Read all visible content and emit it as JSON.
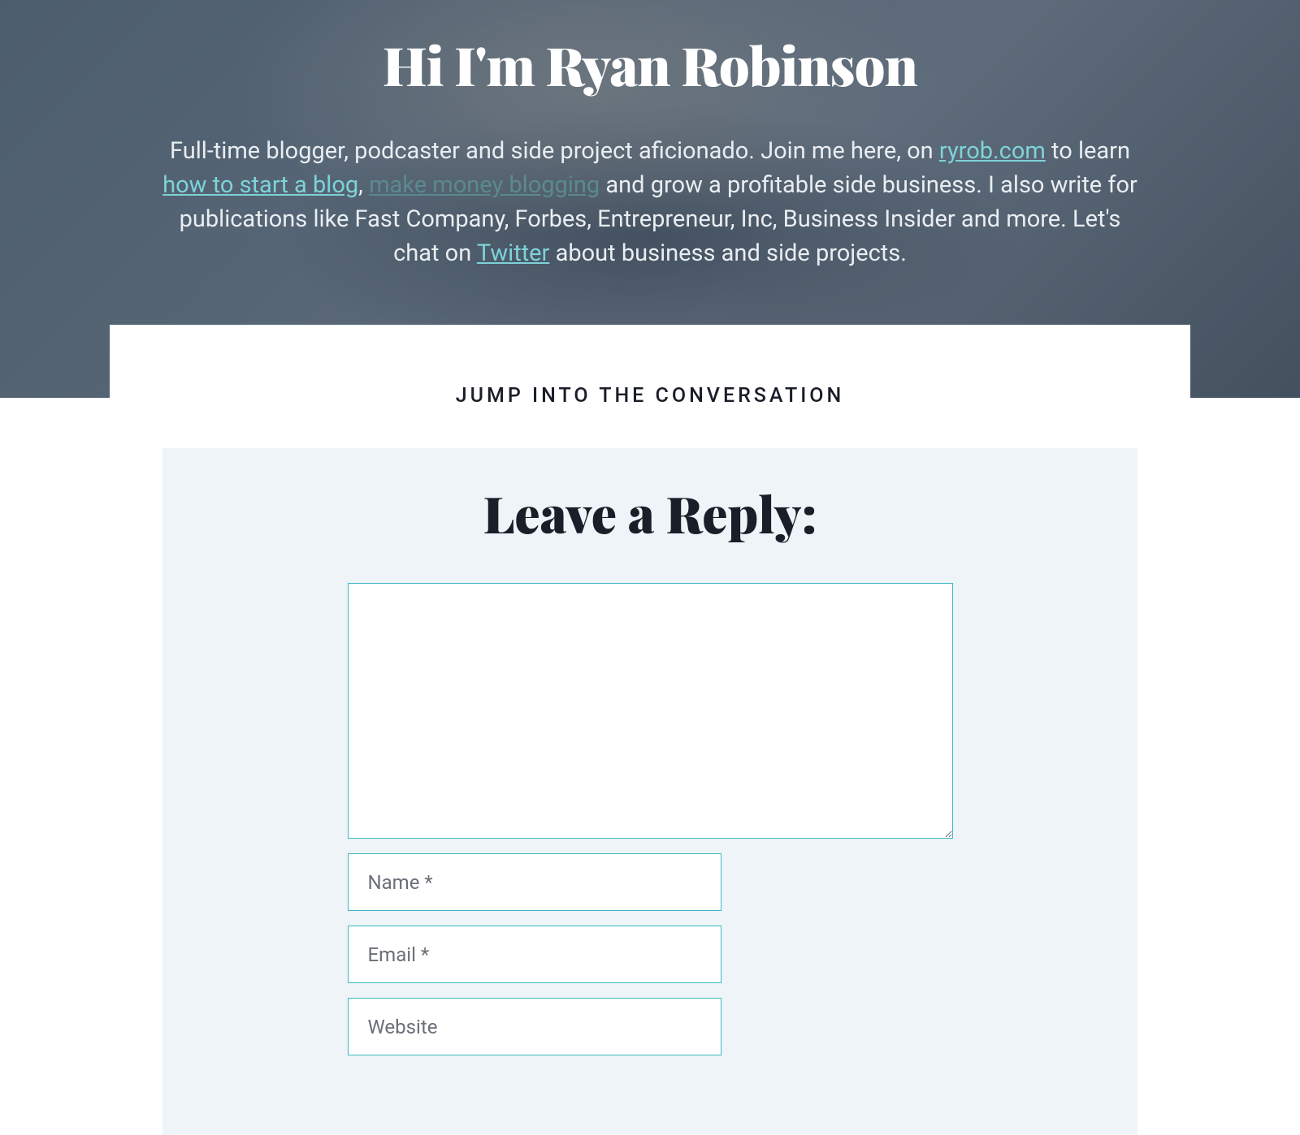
{
  "hero": {
    "title": "Hi I'm Ryan Robinson",
    "desc_part1": "Full-time blogger, podcaster and side project aficionado. Join me here, on ",
    "link_ryrob": "ryrob.com",
    "desc_part2": " to learn ",
    "link_howto": "how to start a blog",
    "desc_part3": ", ",
    "link_money": "make money blogging",
    "desc_part4": " and grow a profitable side business. I also write for publications like Fast Company, Forbes, Entrepreneur, Inc, Business Insider and more. Let's chat on ",
    "link_twitter": "Twitter",
    "desc_part5": " about business and side projects."
  },
  "conversation": {
    "label": "JUMP INTO THE CONVERSATION"
  },
  "reply": {
    "title": "Leave a Reply:",
    "name_placeholder": "Name *",
    "email_placeholder": "Email *",
    "website_placeholder": "Website"
  }
}
